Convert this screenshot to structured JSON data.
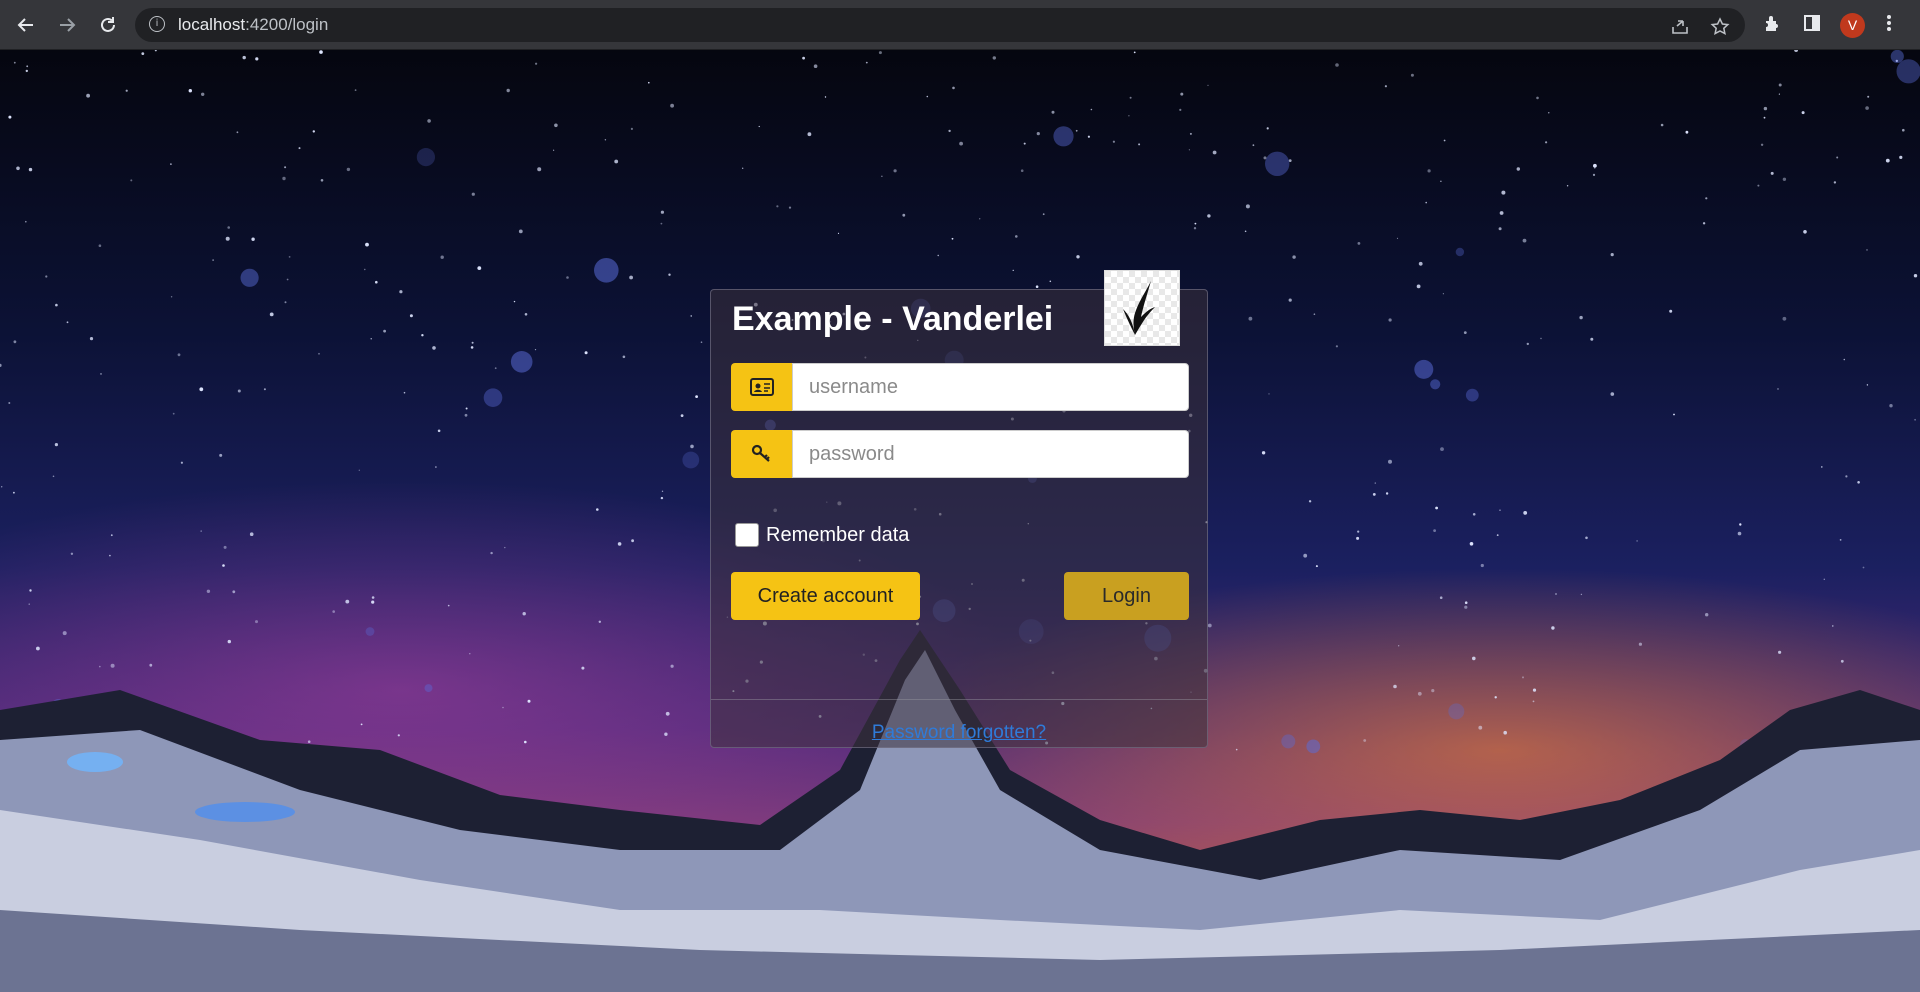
{
  "browser": {
    "url_host": "localhost",
    "url_path": ":4200/login",
    "avatar_letter": "V",
    "icons": [
      "back-icon",
      "forward-icon",
      "reload-icon",
      "info-icon",
      "share-icon",
      "star-icon",
      "extensions-icon",
      "sidepanel-icon",
      "menu-icon"
    ]
  },
  "login": {
    "title": "Example - Vanderlei",
    "username_placeholder": "username",
    "password_placeholder": "password",
    "remember_label": "Remember data",
    "create_label": "Create account",
    "login_label": "Login",
    "forgot_label": "Password forgotten?"
  },
  "colors": {
    "accent": "#f5c314",
    "login_button": "#c9a020",
    "link": "#2f7bd9"
  }
}
